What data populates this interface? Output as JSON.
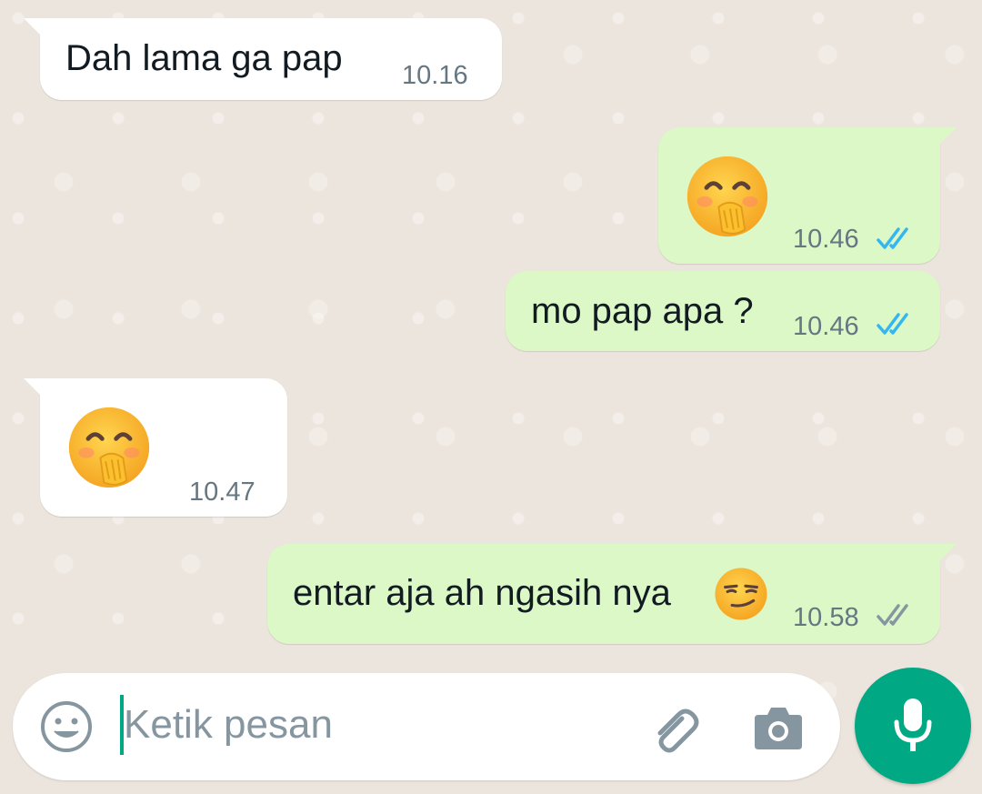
{
  "chat": {
    "messages": [
      {
        "direction": "incoming",
        "text": "Dah lama ga pap",
        "time": "10.16"
      },
      {
        "direction": "outgoing",
        "emoji": "face-with-hand-over-mouth",
        "time": "10.46",
        "status": "read"
      },
      {
        "direction": "outgoing",
        "text": "mo pap apa ?",
        "time": "10.46",
        "status": "read"
      },
      {
        "direction": "incoming",
        "emoji": "face-with-hand-over-mouth",
        "time": "10.47"
      },
      {
        "direction": "outgoing",
        "text": "entar aja ah ngasih nya",
        "emoji": "smirking-face",
        "time": "10.58",
        "status": "delivered"
      }
    ]
  },
  "composer": {
    "placeholder": "Ketik pesan",
    "emoji_icon": "smiley-face-icon",
    "attach_icon": "paperclip-icon",
    "camera_icon": "camera-icon",
    "send_icon": "microphone-icon"
  },
  "colors": {
    "background": "#ece5dd",
    "incoming_bubble": "#ffffff",
    "outgoing_bubble": "#dcf8c6",
    "read_tick": "#34b7f1",
    "delivered_tick": "#8696a0",
    "accent": "#00a884"
  }
}
